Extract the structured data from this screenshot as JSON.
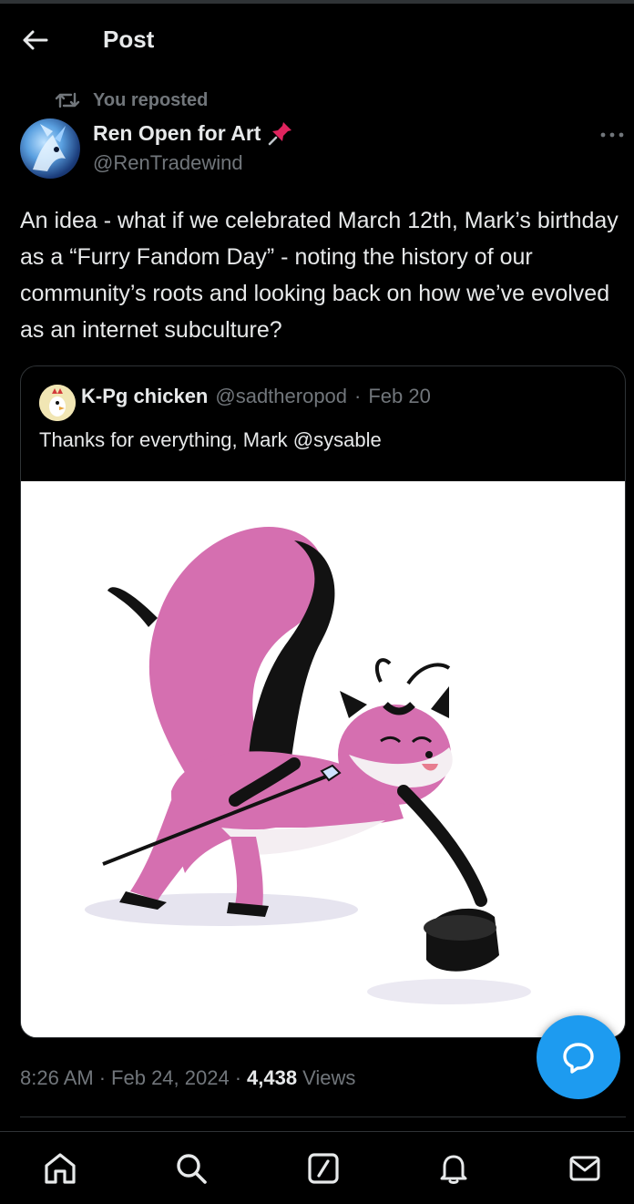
{
  "header": {
    "title": "Post"
  },
  "repost": {
    "label": "You reposted"
  },
  "author": {
    "display_name": "Ren Open for Art",
    "handle": "@RenTradewind"
  },
  "post": {
    "text": "An idea - what if we celebrated March 12th, Mark’s birthday as a “Furry Fandom Day” - noting the history of our community’s roots and looking back on how we’ve evolved as an internet subculture?",
    "time": "8:26 AM",
    "date": "Feb 24, 2024",
    "views_count": "4,438",
    "views_label": "Views"
  },
  "quoted": {
    "display_name": "K-Pg chicken",
    "handle": "@sadtheropod",
    "separator": "·",
    "date": "Feb 20",
    "text": "Thanks for everything, Mark @sysable"
  },
  "meta": {
    "separator": "·"
  },
  "icons": {
    "back": "back-arrow-icon",
    "repost": "repost-icon",
    "pin": "pushpin-icon",
    "more": "more-horizontal-icon",
    "compose_reply": "chat-bubble-icon",
    "nav": [
      "home-icon",
      "search-icon",
      "compose-icon",
      "notifications-bell-icon",
      "messages-envelope-icon"
    ]
  },
  "colors": {
    "background": "#000000",
    "text_primary": "#e7e9ea",
    "text_secondary": "#71767b",
    "accent": "#1d9bf0",
    "border": "#2f3336",
    "pin": "#e0245e"
  }
}
